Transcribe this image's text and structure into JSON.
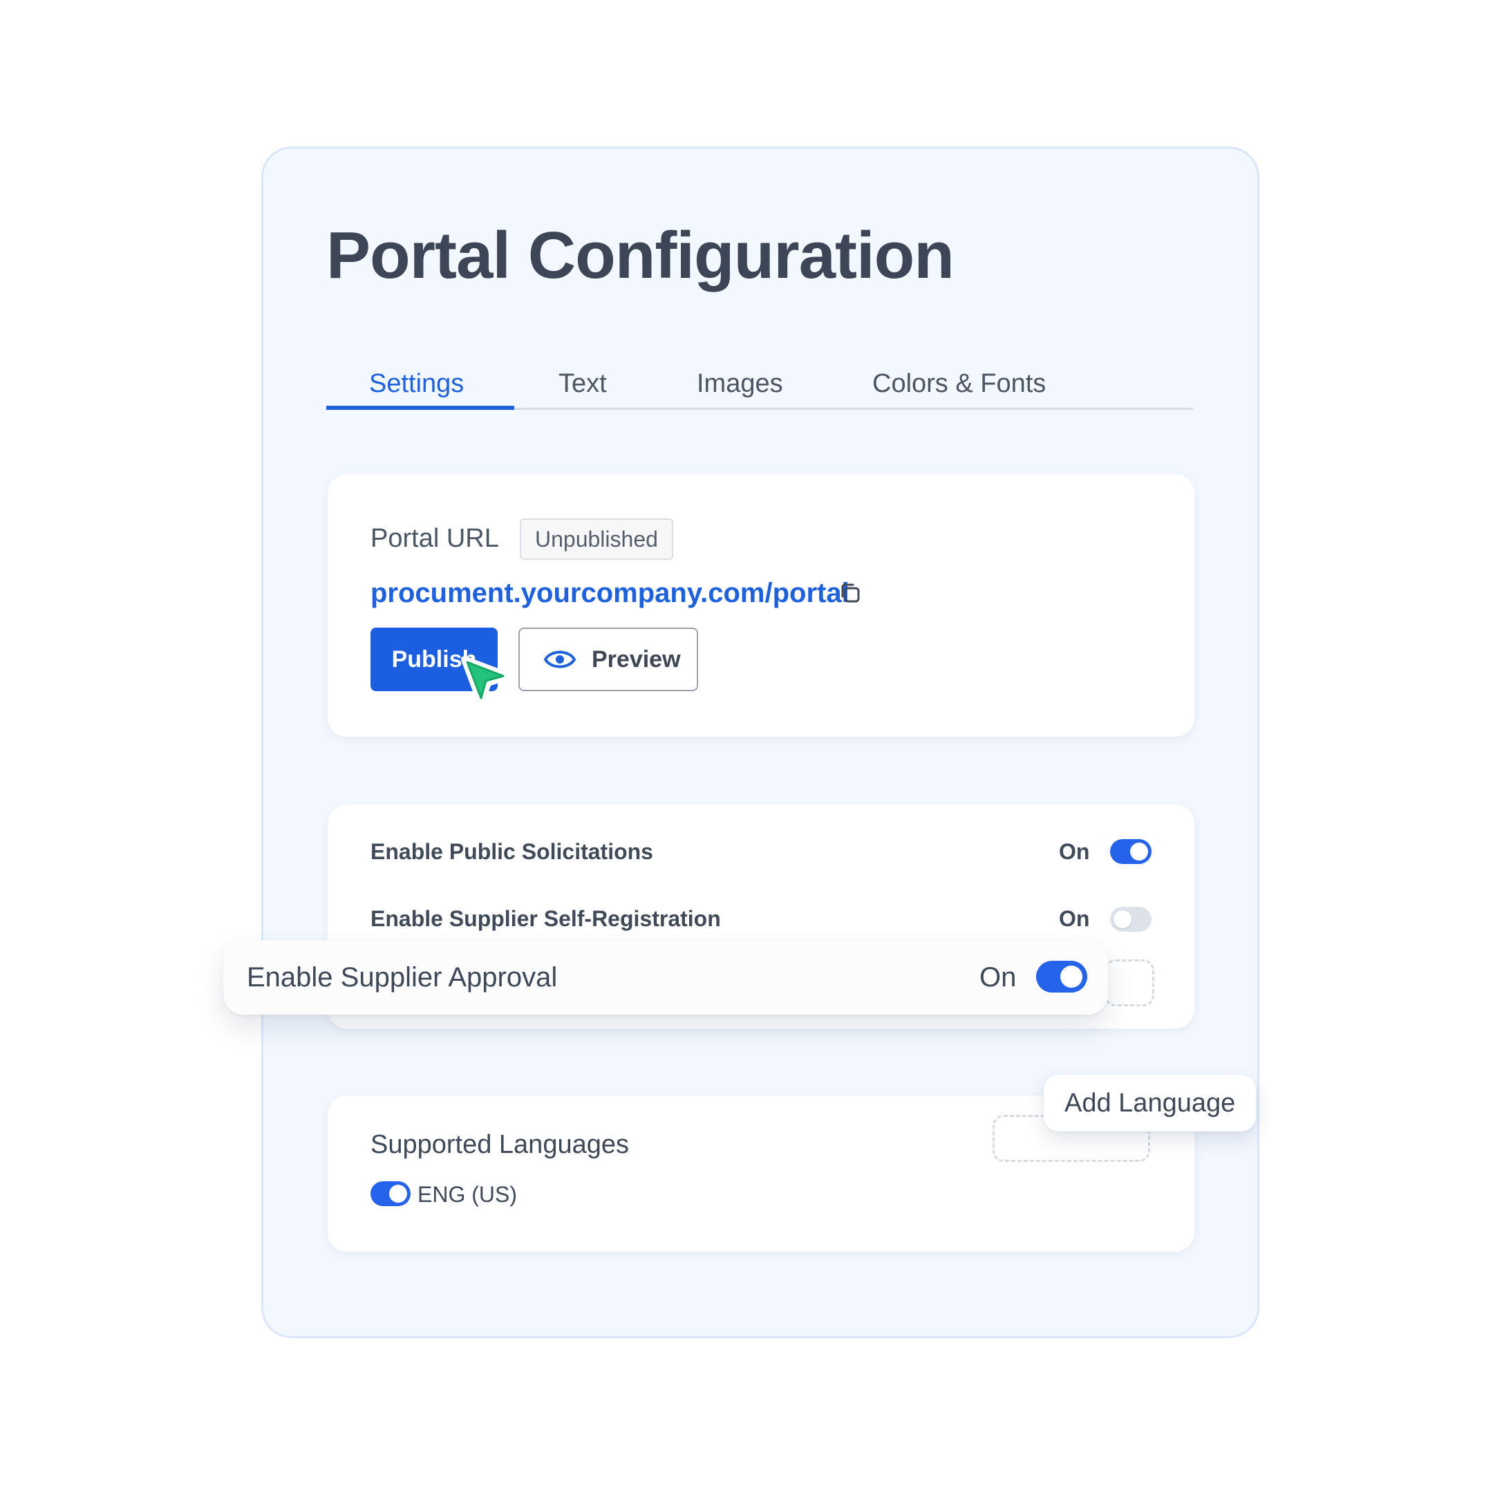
{
  "page": {
    "title": "Portal Configuration"
  },
  "tabs": [
    {
      "label": "Settings",
      "active": true
    },
    {
      "label": "Text",
      "active": false
    },
    {
      "label": "Images",
      "active": false
    },
    {
      "label": "Colors & Fonts",
      "active": false
    }
  ],
  "portal_url": {
    "label": "Portal URL",
    "status_badge": "Unpublished",
    "url": "procument.yourcompany.com/portal",
    "copy_icon": "copy-icon",
    "publish_label": "Publish",
    "preview_label": "Preview",
    "preview_icon": "eye-icon"
  },
  "toggles": [
    {
      "label": "Enable Public Solicitations",
      "state_text": "On",
      "on": true
    },
    {
      "label": "Enable Supplier Self-Registration",
      "state_text": "On",
      "on": false
    }
  ],
  "approval": {
    "label": "Enable Supplier Approval",
    "state_text": "On",
    "on": true
  },
  "languages": {
    "title": "Supported Languages",
    "add_label": "Add Language",
    "items": [
      {
        "label": "ENG (US)",
        "on": true
      }
    ]
  },
  "colors": {
    "accent": "#1d62dc",
    "panel_bg": "#f3f7fe",
    "cursor": "#22c27a"
  }
}
